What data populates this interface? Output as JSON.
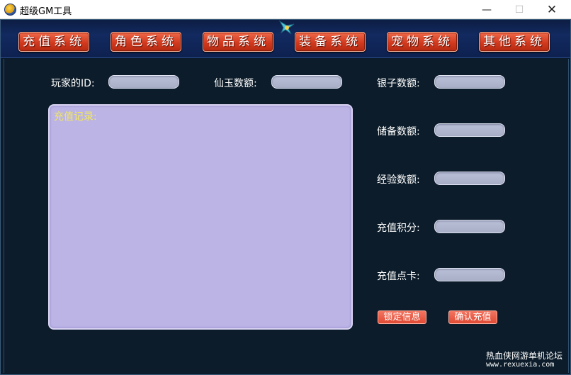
{
  "window": {
    "title": "超级GM工具",
    "minimize_glyph": "—",
    "maximize_glyph": "☐",
    "close_glyph": "✕"
  },
  "tabs": [
    {
      "label": "充值系统"
    },
    {
      "label": "角色系统"
    },
    {
      "label": "物品系统"
    },
    {
      "label": "装备系统"
    },
    {
      "label": "宠物系统"
    },
    {
      "label": "其他系统"
    }
  ],
  "form": {
    "player_id_label": "玩家的ID:",
    "jade_label": "仙玉数额:",
    "silver_label": "银子数额:",
    "reserve_label": "储备数额:",
    "exp_label": "经验数额:",
    "points_label": "充值积分:",
    "card_label": "充值点卡:",
    "player_id_value": "",
    "jade_value": "",
    "silver_value": "",
    "reserve_value": "",
    "exp_value": "",
    "points_value": "",
    "card_value": ""
  },
  "log": {
    "label": "充值记录:"
  },
  "actions": {
    "lock_label": "锁定信息",
    "confirm_label": "确认充值"
  },
  "watermark": {
    "line1": "热血侠网游单机论坛",
    "line2": "www.rexuexia.com"
  },
  "colors": {
    "tab_red": "#d23a1e",
    "background": "#0c1c2a",
    "field": "#b9bfd6",
    "log_box": "#bbb4e5",
    "log_label": "#f3e85a"
  },
  "icons": {
    "app": "gm-app-icon",
    "sprite": "pet-sprite-icon"
  }
}
